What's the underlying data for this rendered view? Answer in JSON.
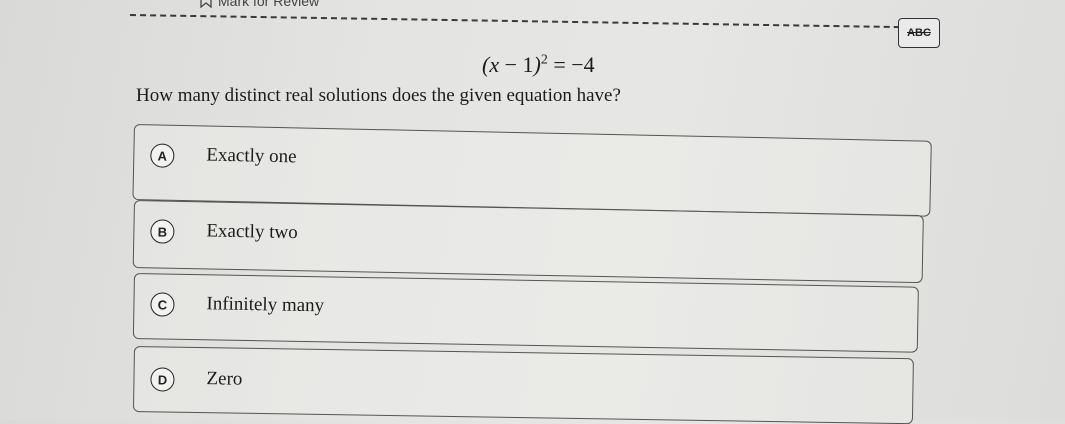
{
  "header": {
    "mark_for_review": "Mark for Review",
    "abc_label": "ABC"
  },
  "question": {
    "equation": {
      "lhs_var": "x",
      "minus": "−",
      "one": "1",
      "exponent": "2",
      "equals": "=",
      "rhs": "−4"
    },
    "prompt": "How many distinct real solutions does the given equation have?"
  },
  "choices": [
    {
      "letter": "A",
      "text": "Exactly one"
    },
    {
      "letter": "B",
      "text": "Exactly two"
    },
    {
      "letter": "C",
      "text": "Infinitely many"
    },
    {
      "letter": "D",
      "text": "Zero"
    }
  ]
}
